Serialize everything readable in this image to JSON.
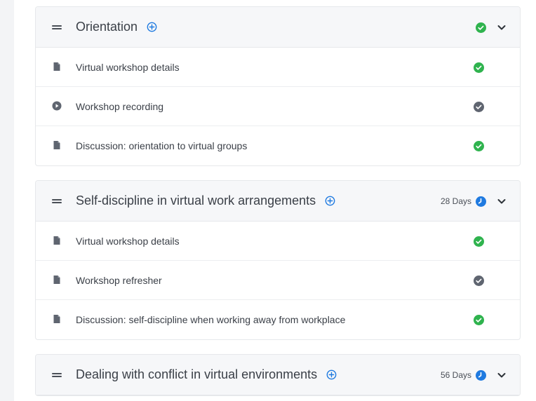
{
  "colors": {
    "complete": "#2fb34e",
    "incomplete": "#5f6570",
    "accent": "#1f7ae0"
  },
  "sections": [
    {
      "title": "Orientation",
      "status": "complete",
      "days": "",
      "items": [
        {
          "type": "document-icon",
          "label": "Virtual workshop details",
          "status": "complete"
        },
        {
          "type": "play-icon",
          "label": "Workshop recording",
          "status": "incomplete"
        },
        {
          "type": "document-icon",
          "label": "Discussion: orientation to virtual groups",
          "status": "complete"
        }
      ]
    },
    {
      "title": "Self-discipline in virtual work arrangements",
      "status": "scheduled",
      "days": "28 Days",
      "items": [
        {
          "type": "document-icon",
          "label": "Virtual workshop details",
          "status": "complete"
        },
        {
          "type": "document-icon",
          "label": "Workshop refresher",
          "status": "incomplete"
        },
        {
          "type": "document-icon",
          "label": "Discussion: self-discipline when working away from workplace",
          "status": "complete"
        }
      ]
    },
    {
      "title": "Dealing with conflict in virtual environments",
      "status": "scheduled",
      "days": "56 Days",
      "items": []
    }
  ]
}
